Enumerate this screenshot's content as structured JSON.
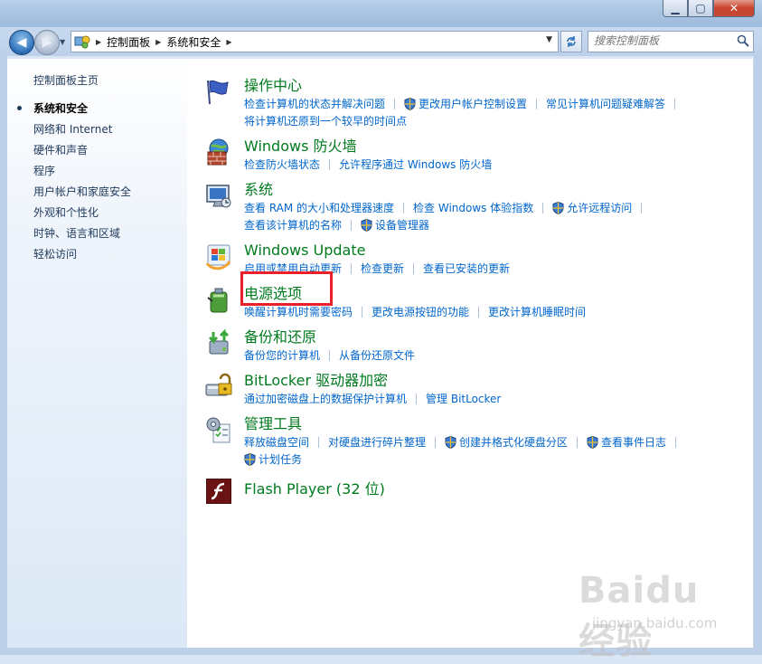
{
  "window": {
    "caption": {
      "minimize": "▭",
      "maximize": "□",
      "close": "✕"
    }
  },
  "nav": {
    "breadcrumb": [
      "控制面板",
      "系统和安全"
    ],
    "search_placeholder": "搜索控制面板"
  },
  "sidebar": {
    "home": "控制面板主页",
    "items": [
      {
        "label": "系统和安全",
        "active": true
      },
      {
        "label": "网络和 Internet",
        "active": false
      },
      {
        "label": "硬件和声音",
        "active": false
      },
      {
        "label": "程序",
        "active": false
      },
      {
        "label": "用户帐户和家庭安全",
        "active": false
      },
      {
        "label": "外观和个性化",
        "active": false
      },
      {
        "label": "时钟、语言和区域",
        "active": false
      },
      {
        "label": "轻松访问",
        "active": false
      }
    ]
  },
  "categories": [
    {
      "title": "操作中心",
      "icon": "flag-icon",
      "rows": [
        [
          "检查计算机的状态并解决问题",
          "更改用户帐户控制设置",
          "常见计算机问题疑难解答"
        ],
        [
          "将计算机还原到一个较早的时间点"
        ]
      ]
    },
    {
      "title": "Windows 防火墙",
      "icon": "firewall-icon",
      "rows": [
        [
          "检查防火墙状态",
          "允许程序通过 Windows 防火墙"
        ]
      ]
    },
    {
      "title": "系统",
      "icon": "computer-icon",
      "rows": [
        [
          "查看 RAM 的大小和处理器速度",
          "检查 Windows 体验指数",
          "允许远程访问"
        ],
        [
          "查看该计算机的名称",
          "设备管理器"
        ]
      ]
    },
    {
      "title": "Windows Update",
      "icon": "windows-update-icon",
      "rows": [
        [
          "启用或禁用自动更新",
          "检查更新",
          "查看已安装的更新"
        ]
      ]
    },
    {
      "title": "电源选项",
      "icon": "battery-icon",
      "rows": [
        [
          "唤醒计算机时需要密码",
          "更改电源按钮的功能",
          "更改计算机睡眠时间"
        ]
      ]
    },
    {
      "title": "备份和还原",
      "icon": "backup-icon",
      "rows": [
        [
          "备份您的计算机",
          "从备份还原文件"
        ]
      ]
    },
    {
      "title": "BitLocker 驱动器加密",
      "icon": "bitlocker-icon",
      "rows": [
        [
          "通过加密磁盘上的数据保护计算机",
          "管理 BitLocker"
        ]
      ]
    },
    {
      "title": "管理工具",
      "icon": "admin-tools-icon",
      "rows": [
        [
          "释放磁盘空间",
          "对硬盘进行碎片整理",
          "创建并格式化硬盘分区",
          "查看事件日志"
        ],
        [
          "计划任务"
        ]
      ]
    },
    {
      "title": "Flash Player (32 位)",
      "icon": "flash-icon",
      "rows": []
    }
  ],
  "watermark": {
    "brand": "Baidu 经验",
    "url": "jingyan.baidu.com"
  }
}
